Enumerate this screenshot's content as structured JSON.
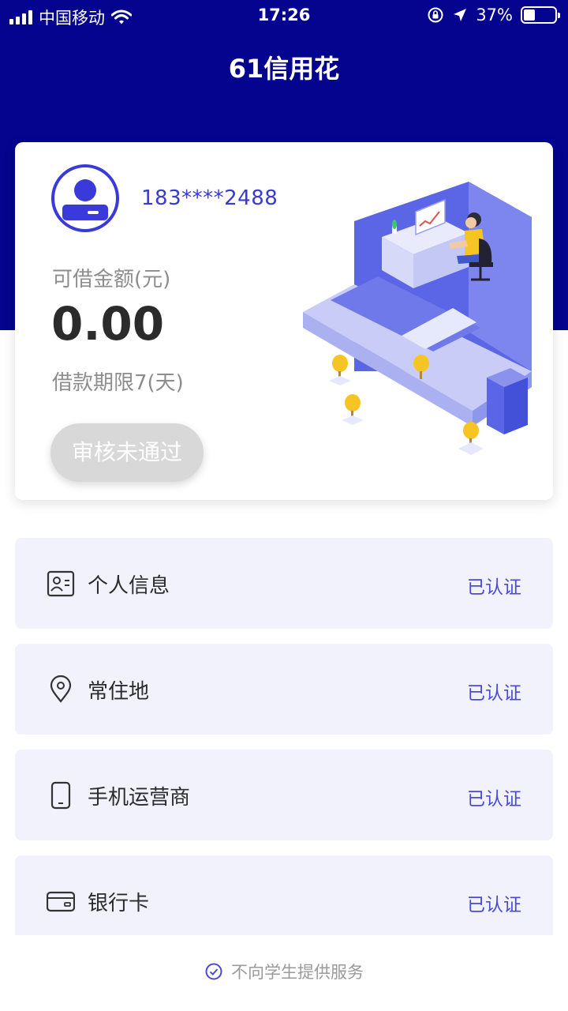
{
  "status_bar": {
    "carrier": "中国移动",
    "time": "17:26",
    "battery_percent": "37%",
    "battery_level": 0.37
  },
  "header": {
    "title": "61信用花"
  },
  "card": {
    "phone": "183****2488",
    "amount_label": "可借金额(元)",
    "amount": "0.00",
    "term_label": "借款期限7(天)",
    "status_button": "审核未通过"
  },
  "auth_items": [
    {
      "label": "个人信息",
      "status": "已认证",
      "icon": "id-card-icon"
    },
    {
      "label": "常住地",
      "status": "已认证",
      "icon": "location-pin-icon"
    },
    {
      "label": "手机运营商",
      "status": "已认证",
      "icon": "mobile-phone-icon"
    },
    {
      "label": "银行卡",
      "status": "已认证",
      "icon": "bank-card-icon"
    }
  ],
  "footer": {
    "text": "不向学生提供服务"
  },
  "colors": {
    "brand": "#04048f",
    "accent": "#3a3adb",
    "item_bg": "#f2f2fd"
  }
}
